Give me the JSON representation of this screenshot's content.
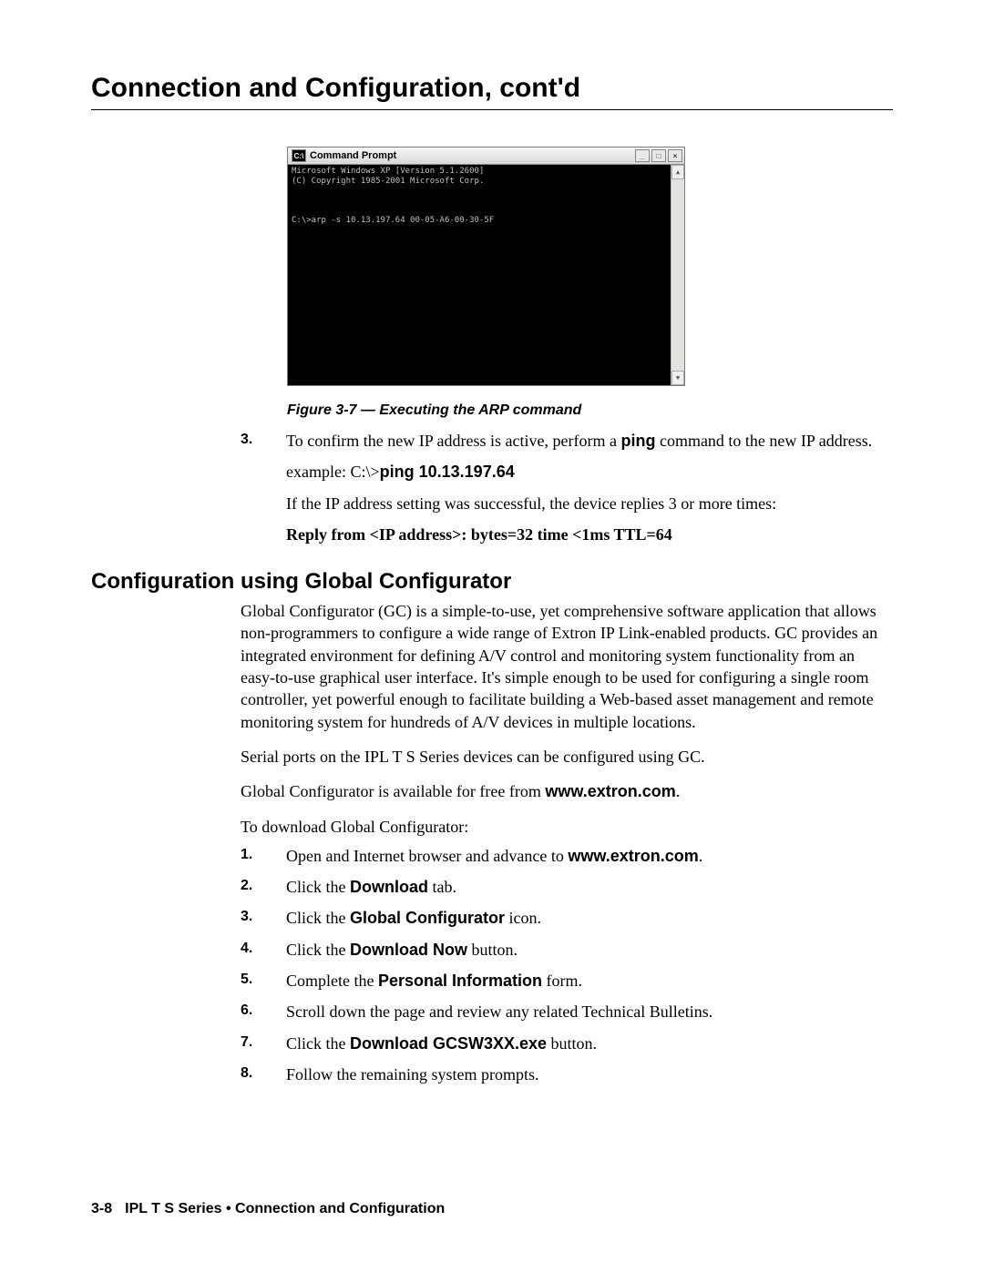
{
  "mainHeading": "Connection and Configuration, cont'd",
  "cmd": {
    "title": "Command Prompt",
    "iconText": "C:\\",
    "minimize": "_",
    "maximize": "□",
    "close": "×",
    "line1": "Microsoft Windows XP [Version 5.1.2600]",
    "line2": "(C) Copyright 1985-2001 Microsoft Corp.",
    "line3": "C:\\>arp -s 10.13.197.64 00-05-A6-00-30-5F",
    "scrollUp": "▲",
    "scrollDown": "▼"
  },
  "figureCaption": "Figure 3-7 — Executing the ARP command",
  "step3": {
    "num": "3.",
    "text_a": "To confirm the new IP address is active, perform a ",
    "text_bold": "ping",
    "text_b": " command to the new IP address.",
    "example_a": "example: C:\\>",
    "example_bold": "ping 10.13.197.64",
    "success": "If the IP address setting was successful, the device replies 3 or more times:",
    "reply": "Reply from <IP address>: bytes=32 time <1ms TTL=64"
  },
  "sectionHeading": "Configuration using Global Configurator",
  "gcPara": "Global Configurator (GC) is a simple-to-use, yet comprehensive software application that allows non-programmers to configure a wide range of Extron IP Link-enabled products.  GC provides an integrated environment for defining A/V control and monitoring system functionality from an easy-to-use graphical user interface.  It's simple enough to be used for configuring a single room controller, yet powerful enough to facilitate building a Web-based asset management and remote monitoring system for hundreds of A/V devices in multiple locations.",
  "serialPara": "Serial ports on the IPL T S Series devices can be configured using GC.",
  "available_a": "Global Configurator is available for free from ",
  "available_link": "www.extron.com",
  "available_b": ".",
  "downloadIntro": "To download Global Configurator:",
  "steps": {
    "s1": {
      "num": "1.",
      "a": "Open and Internet browser and advance to ",
      "bold": "www.extron.com",
      "b": "."
    },
    "s2": {
      "num": "2.",
      "a": "Click the ",
      "bold": "Download",
      "b": " tab."
    },
    "s3": {
      "num": "3.",
      "a": "Click the ",
      "bold": "Global Configurator",
      "b": " icon."
    },
    "s4": {
      "num": "4.",
      "a": "Click the ",
      "bold": "Download Now",
      "b": " button."
    },
    "s5": {
      "num": "5.",
      "a": "Complete the ",
      "bold": "Personal Information",
      "b": " form."
    },
    "s6": {
      "num": "6.",
      "a": "Scroll down the page and review any related Technical Bulletins."
    },
    "s7": {
      "num": "7.",
      "a": "Click the ",
      "bold": "Download GCSW3XX.exe",
      "b": " button."
    },
    "s8": {
      "num": "8.",
      "a": "Follow the remaining system prompts."
    }
  },
  "footer": {
    "page": "3-8",
    "text": "IPL T S Series • Connection and Configuration"
  }
}
